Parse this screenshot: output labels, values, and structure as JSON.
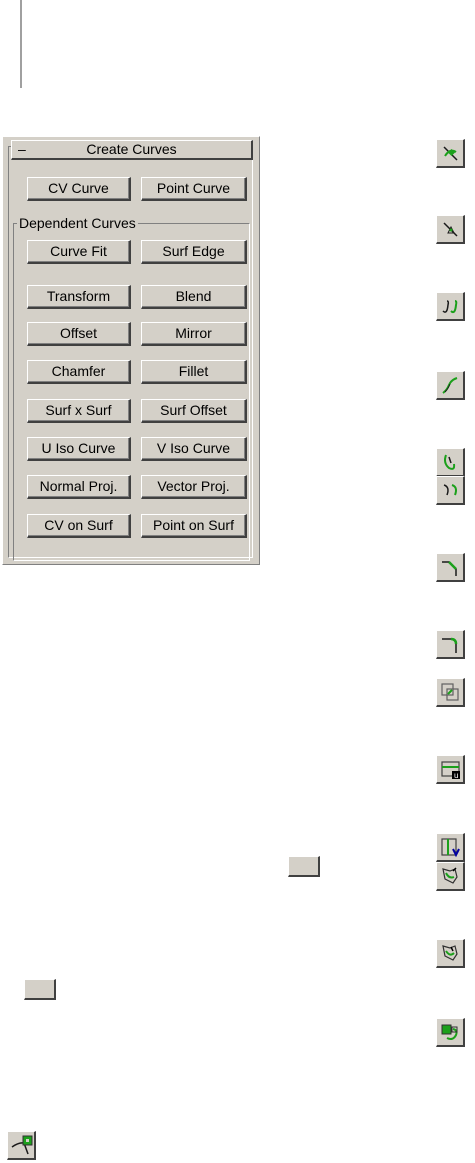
{
  "panel": {
    "collapse_symbol": "–",
    "title": "Create Curves",
    "top_buttons": {
      "cv_curve": "CV Curve",
      "point_curve": "Point Curve"
    },
    "group_label": "Dependent Curves",
    "dependent_buttons": [
      [
        "Curve Fit",
        "Surf Edge"
      ],
      [
        "Transform",
        "Blend"
      ],
      [
        "Offset",
        "Mirror"
      ],
      [
        "Chamfer",
        "Fillet"
      ],
      [
        "Surf x Surf",
        "Surf Offset"
      ],
      [
        "U Iso Curve",
        "V Iso Curve"
      ],
      [
        "Normal Proj.",
        "Vector Proj."
      ],
      [
        "CV on Surf",
        "Point on Surf"
      ]
    ]
  },
  "icons": [
    "cv-curve-icon",
    "point-curve-icon",
    "curve-fit-icon",
    "transform-curve-icon",
    "blend-curve-icon",
    "offset-curve-icon",
    "chamfer-curve-icon",
    "fillet-curve-icon",
    "surf-x-surf-icon",
    "u-iso-curve-icon",
    "v-iso-curve-icon",
    "normal-proj-icon",
    "vector-proj-icon",
    "cv-on-surf-icon",
    "surf-edge-icon"
  ],
  "colors": {
    "panel_bg": "#d4d0c8",
    "icon_green": "#1ba01b"
  }
}
